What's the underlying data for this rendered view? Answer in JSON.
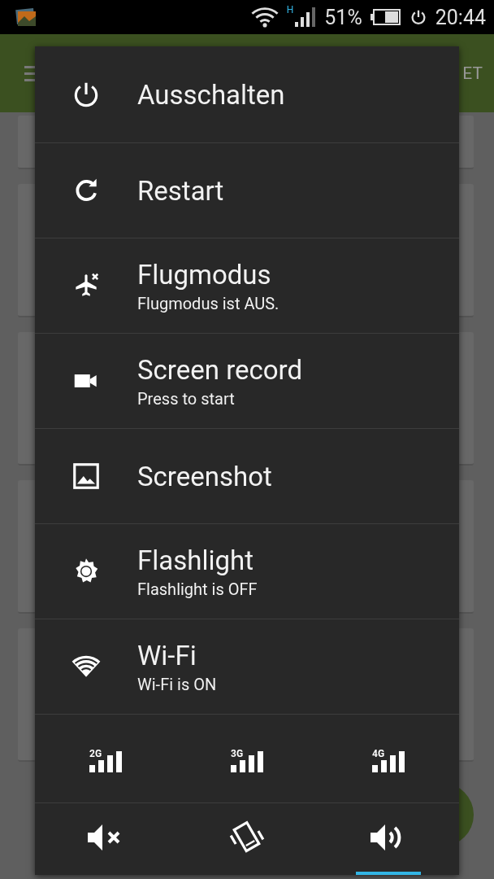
{
  "status_bar": {
    "network_type": "H",
    "battery": "51%",
    "time": "20:44"
  },
  "app_bar": {
    "action": "ET"
  },
  "power_menu": {
    "items": [
      {
        "kind": "power",
        "title": "Ausschalten"
      },
      {
        "kind": "restart",
        "title": "Restart"
      },
      {
        "kind": "airplane",
        "title": "Flugmodus",
        "subtitle": "Flugmodus ist AUS."
      },
      {
        "kind": "record",
        "title": "Screen record",
        "subtitle": "Press to start"
      },
      {
        "kind": "screenshot",
        "title": "Screenshot"
      },
      {
        "kind": "flashlight",
        "title": "Flashlight",
        "subtitle": "Flashlight is OFF"
      },
      {
        "kind": "wifi",
        "title": "Wi-Fi",
        "subtitle": "Wi-Fi is ON"
      }
    ],
    "network_modes": [
      {
        "label": "2G"
      },
      {
        "label": "3G"
      },
      {
        "label": "4G"
      }
    ],
    "sound_modes": [
      {
        "kind": "mute",
        "selected": false
      },
      {
        "kind": "vibrate",
        "selected": false
      },
      {
        "kind": "sound",
        "selected": true
      }
    ]
  }
}
